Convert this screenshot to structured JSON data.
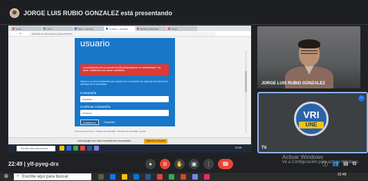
{
  "presenter": {
    "text": "JORGE LUIS RUBIO GONZALEZ está presentando"
  },
  "shared": {
    "tabs": [
      "Gmail",
      "Inicio",
      "Meet - Identidad",
      "Contacto - Identidad",
      "RUBIO GONZALEZ",
      "Gmail"
    ],
    "address": "identidad.une.edu.pe/reset_password?token",
    "card_title": "usuario",
    "alert": "La contraseña para su cuenta ha sido bloqueada por un administrador. Por favor, establezca una nueva contraseña.",
    "help": "Ingrese una nueva contraseña que cumpla con los requisitos de seguridad del sistema de identidad de la universidad.",
    "label1": "Contraseña",
    "value1": "••••••••••",
    "label2": "Confirmar contraseña",
    "value2": "••••••••••",
    "set_button": "Establecer",
    "cancel": "Cancelar",
    "footer_links": "Términos de servicio · Política de privacidad · Términos de identidad · Ayuda",
    "footer_copy": "Identidad © 2021 UNE",
    "share_text": "meet.google.com está compartiendo una pestaña",
    "share_stop": "Dejar de compartir",
    "win_search": "Escribe aquí para buscar",
    "win_clock": "22:49"
  },
  "tiles": {
    "participant1": "JORGE LUIS RUBIO GONZALEZ",
    "badge_vri": "VRI",
    "badge_une": "UNE",
    "participant2_initial": "Tú"
  },
  "meeting": {
    "time_code": "22:49 | ylf-pyeg-drx",
    "activate_title": "Activar Windows",
    "activate_sub": "Ve a Configuración para activar Windows."
  },
  "taskbar": {
    "search_placeholder": "Escribe aquí para buscar",
    "clock": "22:49"
  },
  "colors": {
    "accent": "#1877c9",
    "alert": "#dc3a35",
    "end_call": "#ea4335"
  }
}
